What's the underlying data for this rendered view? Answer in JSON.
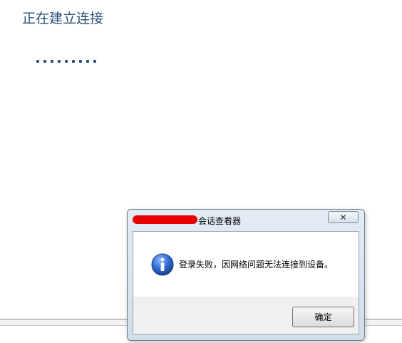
{
  "page": {
    "title": "正在建立连接",
    "loading_dots": 9,
    "accent_color": "#2a4f78"
  },
  "dialog": {
    "title": "会话查看器",
    "redaction_color": "#e60000",
    "close_glyph": "✕",
    "icon": "info-icon",
    "message": "登录失败，因网络问题无法连接到设备。",
    "ok_label": "确定"
  }
}
